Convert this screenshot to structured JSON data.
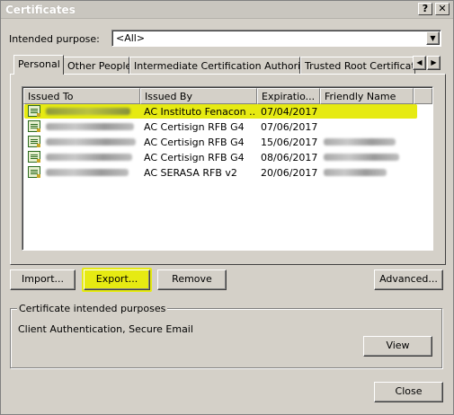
{
  "window": {
    "title": "Certificates",
    "help_glyph": "?",
    "close_glyph": "✕"
  },
  "purpose": {
    "label": "Intended purpose:",
    "value": "<All>",
    "dropdown_glyph": "▼"
  },
  "tabs": [
    {
      "label": "Personal"
    },
    {
      "label": "Other People"
    },
    {
      "label": "Intermediate Certification Authorities"
    },
    {
      "label": "Trusted Root Certification"
    }
  ],
  "tab_scroll": {
    "left_glyph": "◀",
    "right_glyph": "▶"
  },
  "list": {
    "columns": [
      "Issued To",
      "Issued By",
      "Expiratio...",
      "Friendly Name"
    ],
    "rows": [
      {
        "issued_to": "",
        "issued_by": "AC Instituto Fenacon ...",
        "expiration": "07/04/2017",
        "friendly_name": ""
      },
      {
        "issued_to": "",
        "issued_by": "AC Certisign RFB G4",
        "expiration": "07/06/2017",
        "friendly_name": ""
      },
      {
        "issued_to": "",
        "issued_by": "AC Certisign RFB G4",
        "expiration": "15/06/2017",
        "friendly_name": ""
      },
      {
        "issued_to": "",
        "issued_by": "AC Certisign RFB G4",
        "expiration": "08/06/2017",
        "friendly_name": ""
      },
      {
        "issued_to": "",
        "issued_by": "AC SERASA RFB v2",
        "expiration": "20/06/2017",
        "friendly_name": ""
      }
    ],
    "highlight_color": "#e6ea12"
  },
  "buttons": {
    "import": "Import...",
    "export": "Export...",
    "remove": "Remove",
    "advanced": "Advanced...",
    "view": "View",
    "close": "Close"
  },
  "purposes_group": {
    "title": "Certificate intended purposes",
    "text": "Client Authentication, Secure Email"
  },
  "icons": {
    "certificate": "certificate-icon"
  }
}
